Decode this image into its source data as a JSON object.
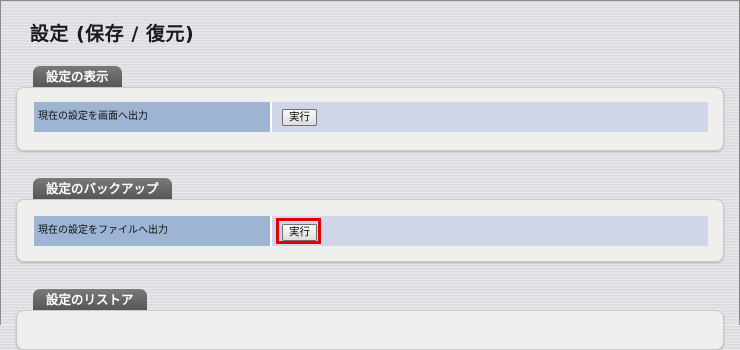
{
  "page": {
    "title": "設定 (保存 / 復元)"
  },
  "sections": [
    {
      "tab": "設定の表示",
      "row_label": "現在の設定を画面へ出力",
      "button": "実行"
    },
    {
      "tab": "設定のバックアップ",
      "row_label": "現在の設定をファイルへ出力",
      "button": "実行",
      "highlighted": true,
      "highlight_color": "#e00000"
    },
    {
      "tab": "設定のリストア"
    }
  ]
}
